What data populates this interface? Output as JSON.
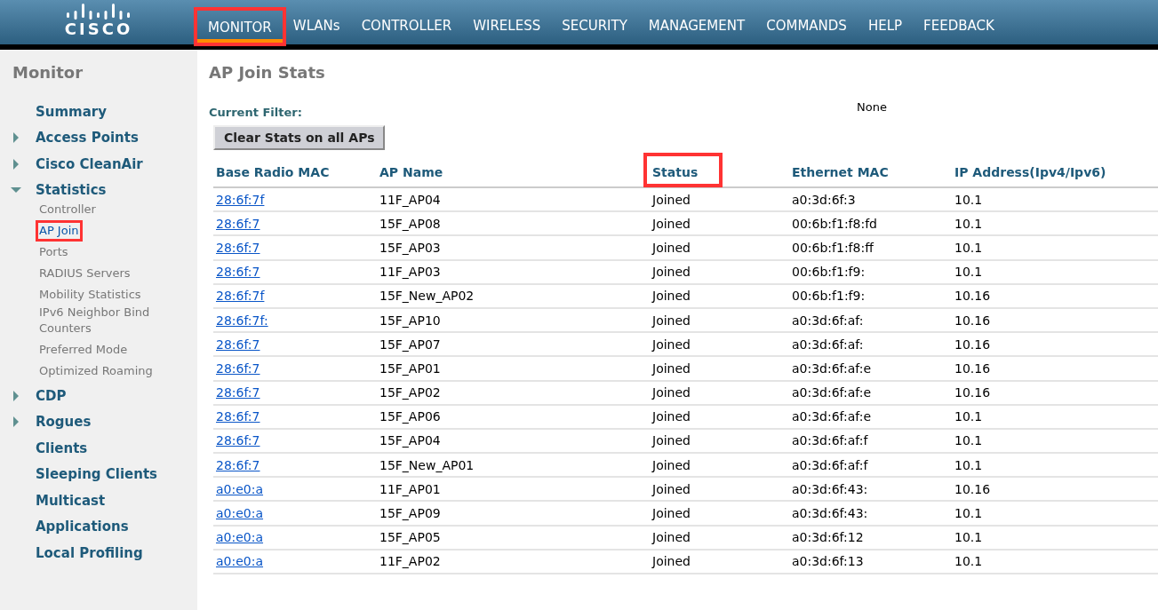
{
  "header": {
    "logo": "CISCO",
    "nav": [
      {
        "label": "MONITOR",
        "selected": true
      },
      {
        "label": "WLANs",
        "selected": false
      },
      {
        "label": "CONTROLLER",
        "selected": false
      },
      {
        "label": "WIRELESS",
        "selected": false
      },
      {
        "label": "SECURITY",
        "selected": false
      },
      {
        "label": "MANAGEMENT",
        "selected": false
      },
      {
        "label": "COMMANDS",
        "selected": false
      },
      {
        "label": "HELP",
        "selected": false
      },
      {
        "label": "FEEDBACK",
        "selected": false
      }
    ]
  },
  "sidebar": {
    "title": "Monitor",
    "items": [
      {
        "label": "Summary",
        "kind": "link"
      },
      {
        "label": "Access Points",
        "kind": "group",
        "expanded": false
      },
      {
        "label": "Cisco CleanAir",
        "kind": "group",
        "expanded": false
      },
      {
        "label": "Statistics",
        "kind": "group",
        "expanded": true,
        "children": [
          {
            "label": "Controller",
            "selected": false
          },
          {
            "label": "AP Join",
            "selected": true
          },
          {
            "label": "Ports",
            "selected": false
          },
          {
            "label": "RADIUS Servers",
            "selected": false
          },
          {
            "label": "Mobility Statistics",
            "selected": false
          },
          {
            "label": "IPv6 Neighbor Bind Counters",
            "selected": false
          },
          {
            "label": "Preferred Mode",
            "selected": false
          },
          {
            "label": "Optimized Roaming",
            "selected": false
          }
        ]
      },
      {
        "label": "CDP",
        "kind": "group",
        "expanded": false
      },
      {
        "label": "Rogues",
        "kind": "group",
        "expanded": false
      },
      {
        "label": "Clients",
        "kind": "link"
      },
      {
        "label": "Sleeping Clients",
        "kind": "link"
      },
      {
        "label": "Multicast",
        "kind": "link"
      },
      {
        "label": "Applications",
        "kind": "link"
      },
      {
        "label": "Local Profiling",
        "kind": "link"
      }
    ]
  },
  "page": {
    "title": "AP Join Stats",
    "filter_label": "Current Filter:",
    "filter_value": "None",
    "clear_button": "Clear Stats on all APs"
  },
  "table": {
    "columns": [
      {
        "label": "Base Radio MAC",
        "highlighted": false
      },
      {
        "label": "AP Name",
        "highlighted": false
      },
      {
        "label": "Status",
        "highlighted": true
      },
      {
        "label": "Ethernet MAC",
        "highlighted": false
      },
      {
        "label": "IP Address(Ipv4/Ipv6)",
        "highlighted": false
      }
    ],
    "rows": [
      [
        "28:6f:7f",
        "11F_AP04",
        "Joined",
        "a0:3d:6f:3",
        "10.1"
      ],
      [
        "28:6f:7",
        "15F_AP08",
        "Joined",
        "00:6b:f1:f8:fd",
        "10.1"
      ],
      [
        "28:6f:7",
        "15F_AP03",
        "Joined",
        "00:6b:f1:f8:ff",
        "10.1"
      ],
      [
        "28:6f:7",
        "11F_AP03",
        "Joined",
        "00:6b:f1:f9:",
        "10.1"
      ],
      [
        "28:6f:7f",
        "15F_New_AP02",
        "Joined",
        "00:6b:f1:f9:",
        "10.16"
      ],
      [
        "28:6f:7f:",
        "15F_AP10",
        "Joined",
        "a0:3d:6f:af:",
        "10.16"
      ],
      [
        "28:6f:7",
        "15F_AP07",
        "Joined",
        "a0:3d:6f:af:",
        "10.16"
      ],
      [
        "28:6f:7",
        "15F_AP01",
        "Joined",
        "a0:3d:6f:af:e",
        "10.16"
      ],
      [
        "28:6f:7",
        "15F_AP02",
        "Joined",
        "a0:3d:6f:af:e",
        "10.16"
      ],
      [
        "28:6f:7",
        "15F_AP06",
        "Joined",
        "a0:3d:6f:af:e",
        "10.1"
      ],
      [
        "28:6f:7",
        "15F_AP04",
        "Joined",
        "a0:3d:6f:af:f",
        "10.1"
      ],
      [
        "28:6f:7",
        "15F_New_AP01",
        "Joined",
        "a0:3d:6f:af:f",
        "10.1"
      ],
      [
        "a0:e0:a",
        "11F_AP01",
        "Joined",
        "a0:3d:6f:43:",
        "10.16"
      ],
      [
        "a0:e0:a",
        "15F_AP09",
        "Joined",
        "a0:3d:6f:43:",
        "10.1"
      ],
      [
        "a0:e0:a",
        "15F_AP05",
        "Joined",
        "a0:3d:6f:12",
        "10.1"
      ],
      [
        "a0:e0:a",
        "11F_AP02",
        "Joined",
        "a0:3d:6f:13",
        "10.1"
      ]
    ]
  }
}
